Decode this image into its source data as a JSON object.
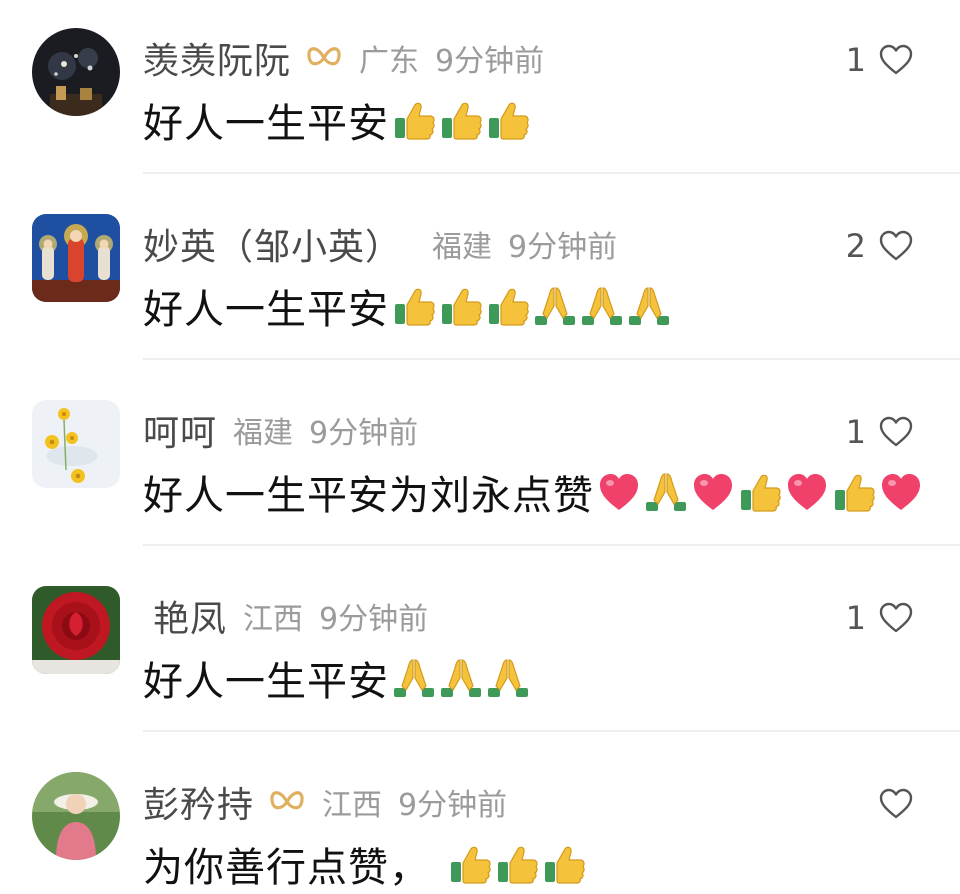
{
  "comments": [
    {
      "username": "羡羡阮阮",
      "has_badge": true,
      "location": "广东",
      "time": "9分钟前",
      "text": "好人一生平安",
      "emojis": [
        "thumbs-up",
        "thumbs-up",
        "thumbs-up"
      ],
      "likes": "1",
      "avatar": "fireworks-night-avatar"
    },
    {
      "username": "妙英（邹小英）",
      "has_badge": false,
      "location": "福建",
      "time": "9分钟前",
      "text": "好人一生平安",
      "emojis": [
        "thumbs-up",
        "thumbs-up",
        "thumbs-up",
        "folded-hands",
        "folded-hands",
        "folded-hands"
      ],
      "likes": "2",
      "avatar": "buddha-painting-avatar"
    },
    {
      "username": "呵呵",
      "has_badge": false,
      "location": "福建",
      "time": "9分钟前",
      "text": "好人一生平安为刘永点赞",
      "emojis": [
        "red-heart",
        "folded-hands",
        "red-heart",
        "thumbs-up",
        "red-heart",
        "thumbs-up",
        "red-heart"
      ],
      "likes": "1",
      "avatar": "daisy-flowers-avatar"
    },
    {
      "username": "艳凤",
      "has_badge": false,
      "location": "江西",
      "time": "9分钟前",
      "text": "好人一生平安",
      "emojis": [
        "folded-hands",
        "folded-hands",
        "folded-hands"
      ],
      "likes": "1",
      "avatar": "red-rose-avatar"
    },
    {
      "username": "彭矜持",
      "has_badge": true,
      "location": "江西",
      "time": "9分钟前",
      "text": "为你善行点赞，",
      "emojis": [
        "thumbs-up",
        "thumbs-up",
        "thumbs-up"
      ],
      "likes": "",
      "avatar": "woman-in-hat-avatar"
    }
  ],
  "colors": {
    "username": "#4a4a4a",
    "meta": "#9b9b9b",
    "body": "#111111",
    "badge": "#e0b060",
    "heart_outline": "#555555",
    "divider": "#eeeeee"
  }
}
